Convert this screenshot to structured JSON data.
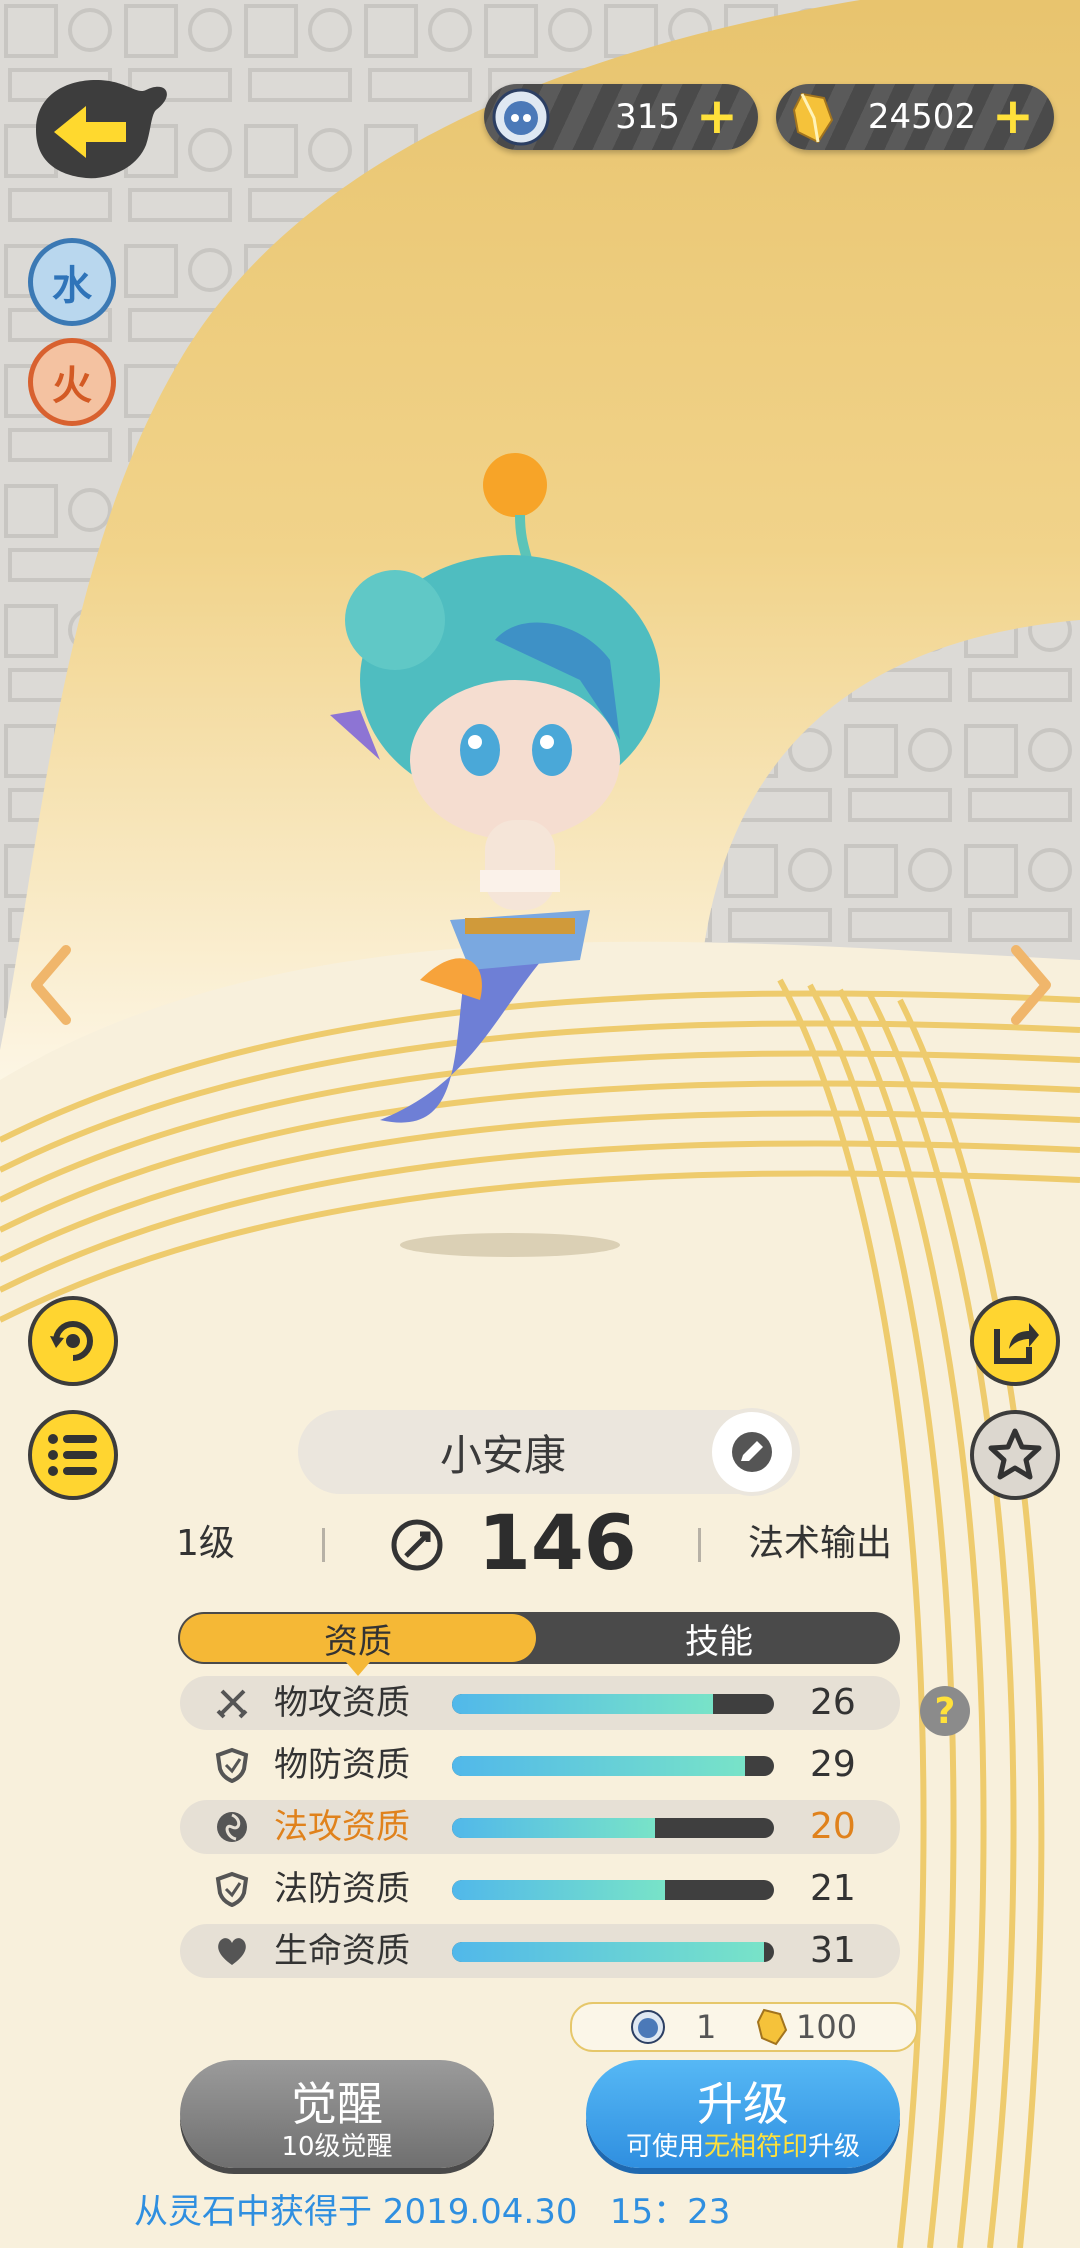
{
  "currency": {
    "orbs": "315",
    "crystals": "24502",
    "plus": "+"
  },
  "elements": [
    "水",
    "火"
  ],
  "monster": {
    "name": "小安康",
    "level": "1级",
    "power": "146",
    "role": "法术输出"
  },
  "tabs": [
    "资质",
    "技能"
  ],
  "stats": [
    {
      "label": "物攻资质",
      "value": "26",
      "fill": 0.81,
      "icon": "sword-icon",
      "shaded": true,
      "highlight": false
    },
    {
      "label": "物防资质",
      "value": "29",
      "fill": 0.91,
      "icon": "shield-icon",
      "shaded": false,
      "highlight": false
    },
    {
      "label": "法攻资质",
      "value": "20",
      "fill": 0.63,
      "icon": "spell-icon",
      "shaded": true,
      "highlight": true
    },
    {
      "label": "法防资质",
      "value": "21",
      "fill": 0.66,
      "icon": "shield-icon",
      "shaded": false,
      "highlight": false
    },
    {
      "label": "生命资质",
      "value": "31",
      "fill": 0.97,
      "icon": "heart-icon",
      "shaded": true,
      "highlight": false
    }
  ],
  "help": "?",
  "cost": {
    "orbs": "1",
    "crystals": "100"
  },
  "buttons": {
    "awaken_title": "觉醒",
    "awaken_sub": "10级觉醒",
    "upgrade_title": "升级",
    "upgrade_sub_pre": "可使用",
    "upgrade_sub_hl": "无相符印",
    "upgrade_sub_post": "升级"
  },
  "footer": "从灵石中获得于 2019.04.30   15：23",
  "colors": {
    "accent": "#f5b836",
    "blue": "#3f9de6",
    "highlight": "#e0821c",
    "footer": "#2f8fe0"
  }
}
